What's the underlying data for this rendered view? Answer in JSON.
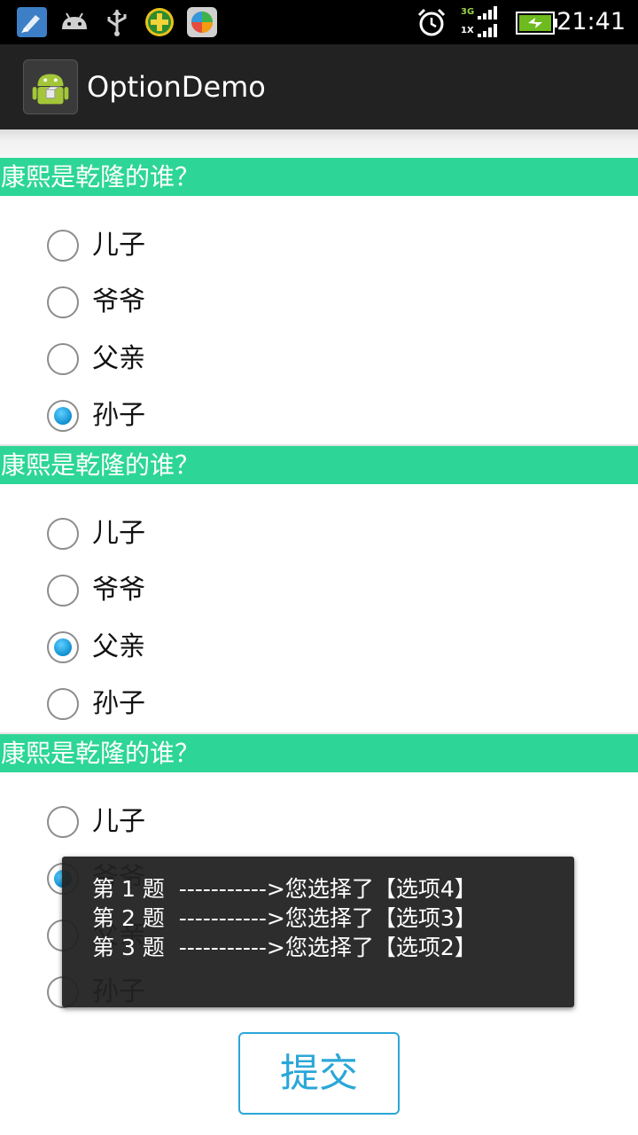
{
  "status_bar": {
    "time": "21:41",
    "network_top": "3G",
    "network_bottom": "1X",
    "icons": [
      "paintbrush-icon",
      "android-icon",
      "usb-icon",
      "game-plus-icon",
      "app-store-icon",
      "alarm-icon",
      "signal-icon",
      "battery-icon"
    ]
  },
  "action_bar": {
    "title": "OptionDemo",
    "icon": "android-app-icon"
  },
  "questions": [
    {
      "title": "康熙是乾隆的谁？",
      "options": [
        "儿子",
        "爷爷",
        "父亲",
        "孙子"
      ],
      "selected": 3
    },
    {
      "title": "康熙是乾隆的谁？",
      "options": [
        "儿子",
        "爷爷",
        "父亲",
        "孙子"
      ],
      "selected": 2
    },
    {
      "title": "康熙是乾隆的谁？",
      "options": [
        "儿子",
        "爷爷",
        "父亲",
        "孙子"
      ],
      "selected": 1
    }
  ],
  "toast": {
    "lines": [
      "第 1 题  ----------->您选择了【选项4】",
      "第 2 题  ----------->您选择了【选项3】",
      "第 3 题  ----------->您选择了【选项2】"
    ]
  },
  "submit": {
    "label": "提交"
  },
  "colors": {
    "accent_green": "#2dd696",
    "button_blue": "#2aa7d8",
    "action_bar": "#222222"
  }
}
